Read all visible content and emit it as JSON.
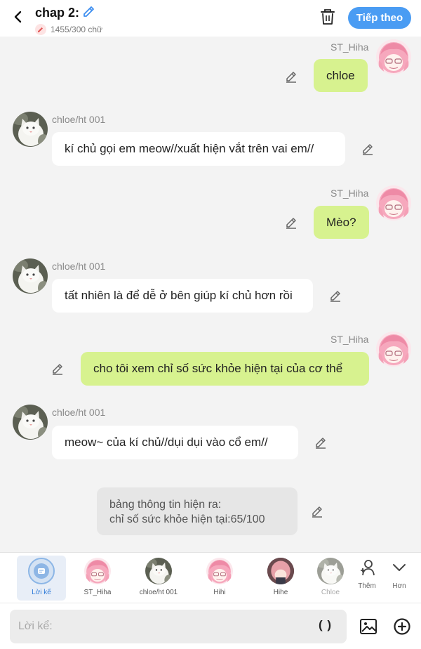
{
  "header": {
    "title": "chap 2:",
    "word_count": "1455/300 chữ",
    "next_label": "Tiếp theo"
  },
  "messages": [
    {
      "side": "right",
      "name": "ST_Hiha",
      "text": "chloe"
    },
    {
      "side": "left",
      "name": "chloe/ht 001",
      "text": "kí chủ gọi em meow//xuất hiện vắt trên vai em//"
    },
    {
      "side": "right",
      "name": "ST_Hiha",
      "text": "Mèo?"
    },
    {
      "side": "left",
      "name": "chloe/ht 001",
      "text": "tất nhiên là để dễ ở bên giúp kí chủ hơn rồi"
    },
    {
      "side": "right",
      "name": "ST_Hiha",
      "text": "cho tôi xem chỉ số sức khỏe hiện tại của cơ thể"
    },
    {
      "side": "left",
      "name": "chloe/ht 001",
      "text": "meow~ của kí chủ//dụi dụi vào cổ em//"
    }
  ],
  "narration": {
    "line1": "bảng thông tin hiện ra:",
    "line2": "chỉ số sức khỏe hiện tại:65/100"
  },
  "characters": [
    {
      "label": "Lời kể",
      "icon": "narration-icon",
      "active": true
    },
    {
      "label": "ST_Hiha",
      "icon": "pink-hair-avatar"
    },
    {
      "label": "chloe/ht 001",
      "icon": "white-cat-avatar"
    },
    {
      "label": "Hihi",
      "icon": "pink-hair-glasses-avatar"
    },
    {
      "label": "Hihe",
      "icon": "pink-hair-dark-avatar"
    },
    {
      "label": "Chloe",
      "icon": "white-cat-avatar"
    }
  ],
  "tools": {
    "add_label": "Thêm",
    "more_label": "Hơn"
  },
  "input": {
    "placeholder": "Lời kể:",
    "paren_label": "( )"
  },
  "colors": {
    "accent": "#4a9cf3",
    "right_bubble": "#d7f28f",
    "left_bubble": "#ffffff",
    "narration_bubble": "#e6e6e6",
    "background": "#f3f3f3"
  }
}
